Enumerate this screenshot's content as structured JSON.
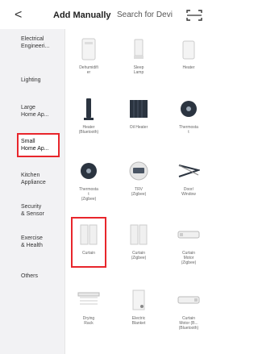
{
  "header": {
    "back_glyph": "<",
    "tab_manual": "Add Manually",
    "tab_search": "Search for Devi",
    "scan_glyph": "[-"
  },
  "sidebar": {
    "items": [
      {
        "label_line1": "Electrical",
        "label_line2": "Engineeri..."
      },
      {
        "label_line1": "Lighting",
        "label_line2": ""
      },
      {
        "label_line1": "Large",
        "label_line2": "Home Ap..."
      },
      {
        "label_line1": "Small",
        "label_line2": "Home Ap...",
        "selected": true
      },
      {
        "label_line1": "Kitchen",
        "label_line2": "Appliance"
      },
      {
        "label_line1": "Security",
        "label_line2": "& Sensor"
      },
      {
        "label_line1": "Exercise",
        "label_line2": "& Health"
      },
      {
        "label_line1": "Others",
        "label_line2": ""
      }
    ]
  },
  "devices": [
    {
      "line1": "Dehumidifi",
      "line2": "er",
      "line3": "",
      "icon": "dehumidifier-icon"
    },
    {
      "line1": "Sleep",
      "line2": "Lamp",
      "line3": "",
      "icon": "lamp-icon"
    },
    {
      "line1": "Heater",
      "line2": "",
      "line3": "",
      "icon": "heater-icon"
    },
    {
      "line1": "Heater",
      "line2": "(Bluetooth)",
      "line3": "",
      "icon": "tower-heater-icon"
    },
    {
      "line1": "Oil Heater",
      "line2": "",
      "line3": "",
      "icon": "oil-heater-icon"
    },
    {
      "line1": "Thermosta",
      "line2": "t",
      "line3": "",
      "icon": "thermostat-icon"
    },
    {
      "line1": "Thermosta",
      "line2": "t",
      "line3": "(Zigbee)",
      "icon": "thermostat-zigbee-icon"
    },
    {
      "line1": "TRV",
      "line2": "(Zigbee)",
      "line3": "",
      "icon": "trv-icon"
    },
    {
      "line1": "Door/",
      "line2": "Window",
      "line3": "",
      "icon": "window-opener-icon"
    },
    {
      "line1": "Curtain",
      "line2": "",
      "line3": "",
      "icon": "curtain-icon",
      "selected": true
    },
    {
      "line1": "Curtain",
      "line2": "(Zigbee)",
      "line3": "",
      "icon": "curtain-zigbee-icon"
    },
    {
      "line1": "Curtain",
      "line2": "Motor",
      "line3": "(Zigbee)",
      "icon": "curtain-motor-icon"
    },
    {
      "line1": "Drying",
      "line2": "Rack",
      "line3": "",
      "icon": "drying-rack-icon"
    },
    {
      "line1": "Electric",
      "line2": "Blanket",
      "line3": "",
      "icon": "electric-blanket-icon"
    },
    {
      "line1": "Curtain",
      "line2": "Motor (B...",
      "line3": "(Bluetooth)",
      "icon": "curtain-motor-bt-icon"
    }
  ],
  "colors": {
    "highlight": "#e8262c",
    "sidebar_bg": "#f2f2f4",
    "icon_dark": "#2b3440"
  }
}
